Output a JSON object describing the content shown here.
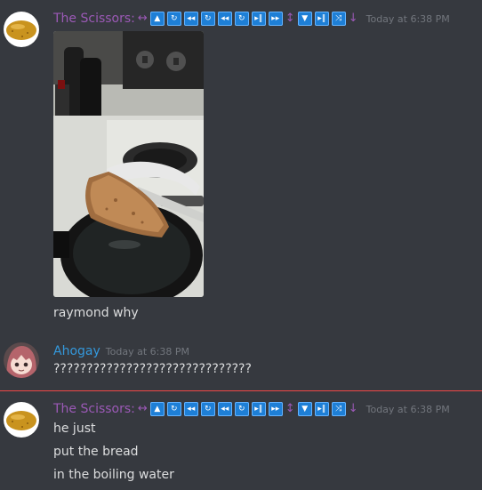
{
  "messages": [
    {
      "username": "The Scissors:",
      "timestamp": "Today at 6:38 PM",
      "emotes": [
        "left-right-arrow",
        "up-triangle",
        "repeat",
        "rewind",
        "repeat",
        "rewind",
        "repeat",
        "play-pause",
        "fast-forward",
        "up-down-arrow",
        "down-triangle",
        "play-pause",
        "shuffle",
        "down-arrow"
      ],
      "text": "raymond why"
    },
    {
      "username": "Ahogay",
      "timestamp": "Today at 6:38 PM",
      "text": "??????????????????????????????"
    },
    {
      "username": "The Scissors:",
      "timestamp": "Today at 6:38 PM",
      "emotes": [
        "left-right-arrow",
        "up-triangle",
        "repeat",
        "rewind",
        "repeat",
        "rewind",
        "repeat",
        "play-pause",
        "fast-forward",
        "up-down-arrow",
        "down-triangle",
        "play-pause",
        "shuffle",
        "down-arrow"
      ],
      "lines": [
        "he just",
        "put the bread",
        "in the boiling water"
      ]
    }
  ],
  "colors": {
    "background": "#36393f",
    "scissors_name": "#9b59b6",
    "ahogay_name": "#3498db",
    "timestamp": "#72767d",
    "new_messages_divider": "#f04747"
  }
}
